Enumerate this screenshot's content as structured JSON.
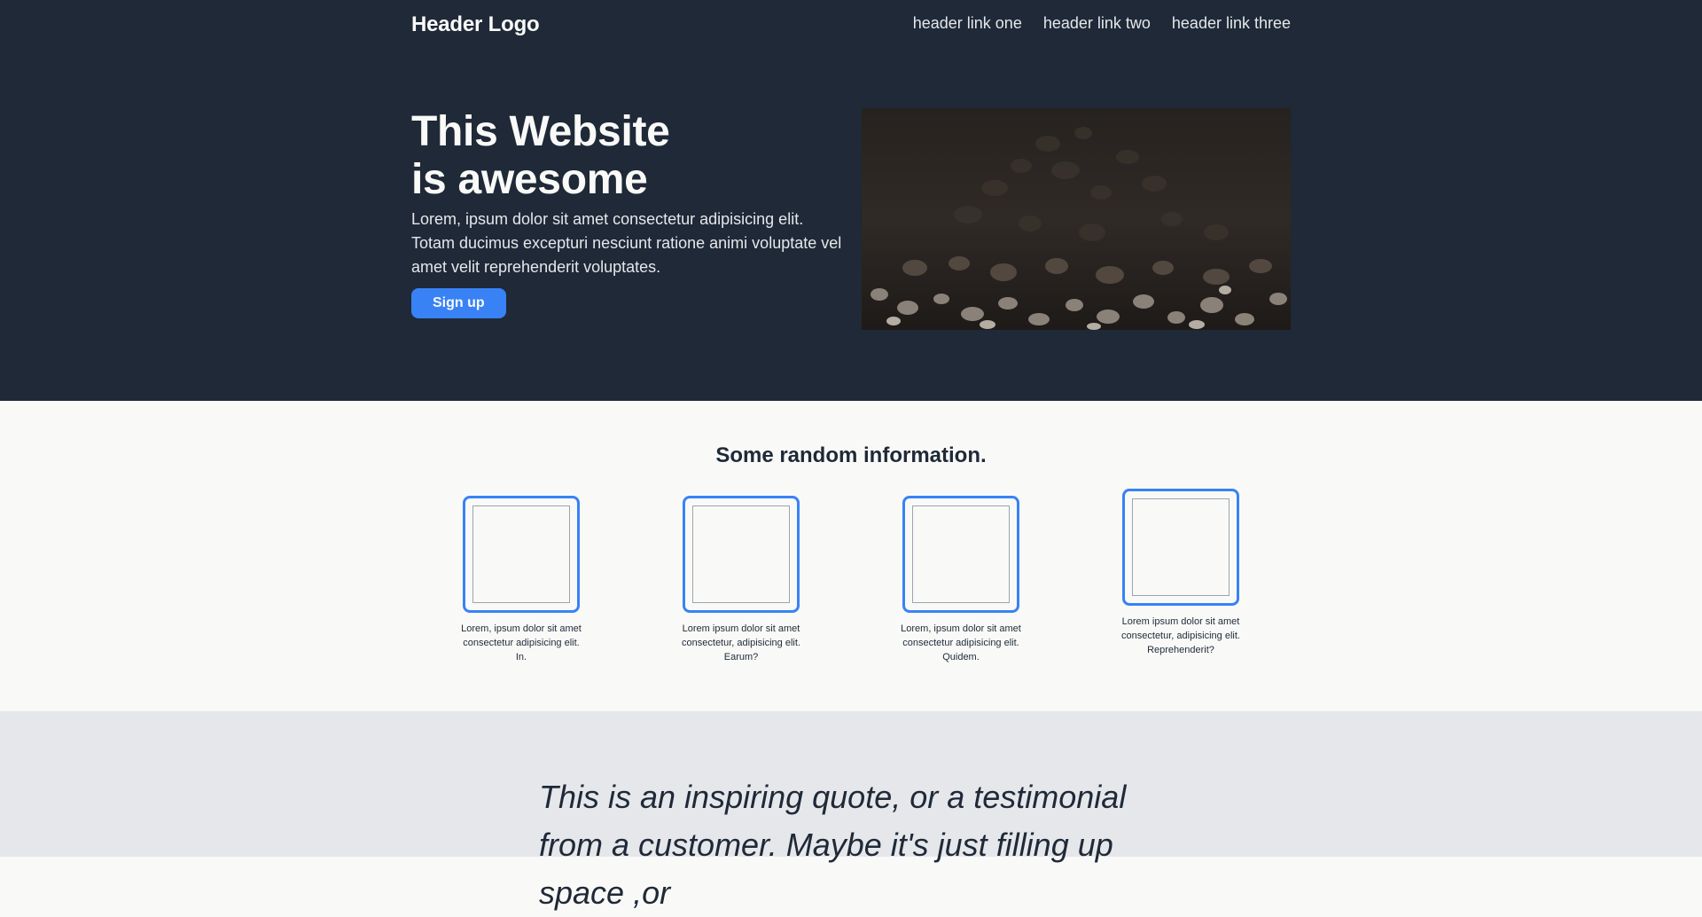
{
  "header": {
    "logo": "Header Logo",
    "links": [
      "header link one",
      "header link two",
      "header link three"
    ]
  },
  "hero": {
    "title_line_1": "This Website",
    "title_line_2": "is awesome",
    "text": "Lorem, ipsum dolor sit amet consectetur adipisicing elit. Totam ducimus excepturi nesciunt ratione animi voluptate vel amet velit reprehenderit voluptates.",
    "button_label": "Sign up"
  },
  "info": {
    "title": "Some random information.",
    "cards": [
      "Lorem, ipsum dolor sit amet consectetur adipisicing elit. In.",
      "Lorem ipsum dolor sit amet consectetur, adipisicing elit. Earum?",
      "Lorem, ipsum dolor sit amet consectetur adipisicing elit. Quidem.",
      "Lorem ipsum dolor sit amet consectetur, adipisicing elit. Reprehenderit?"
    ]
  },
  "quote": {
    "text": "This is an inspiring quote, or a testimonial from a customer. Maybe it's just filling up space ,or"
  },
  "colors": {
    "hero_bg": "#1f2937",
    "accent": "#3882f6",
    "light_bg": "#f9faf8",
    "quote_bg": "#e5e7eb"
  }
}
